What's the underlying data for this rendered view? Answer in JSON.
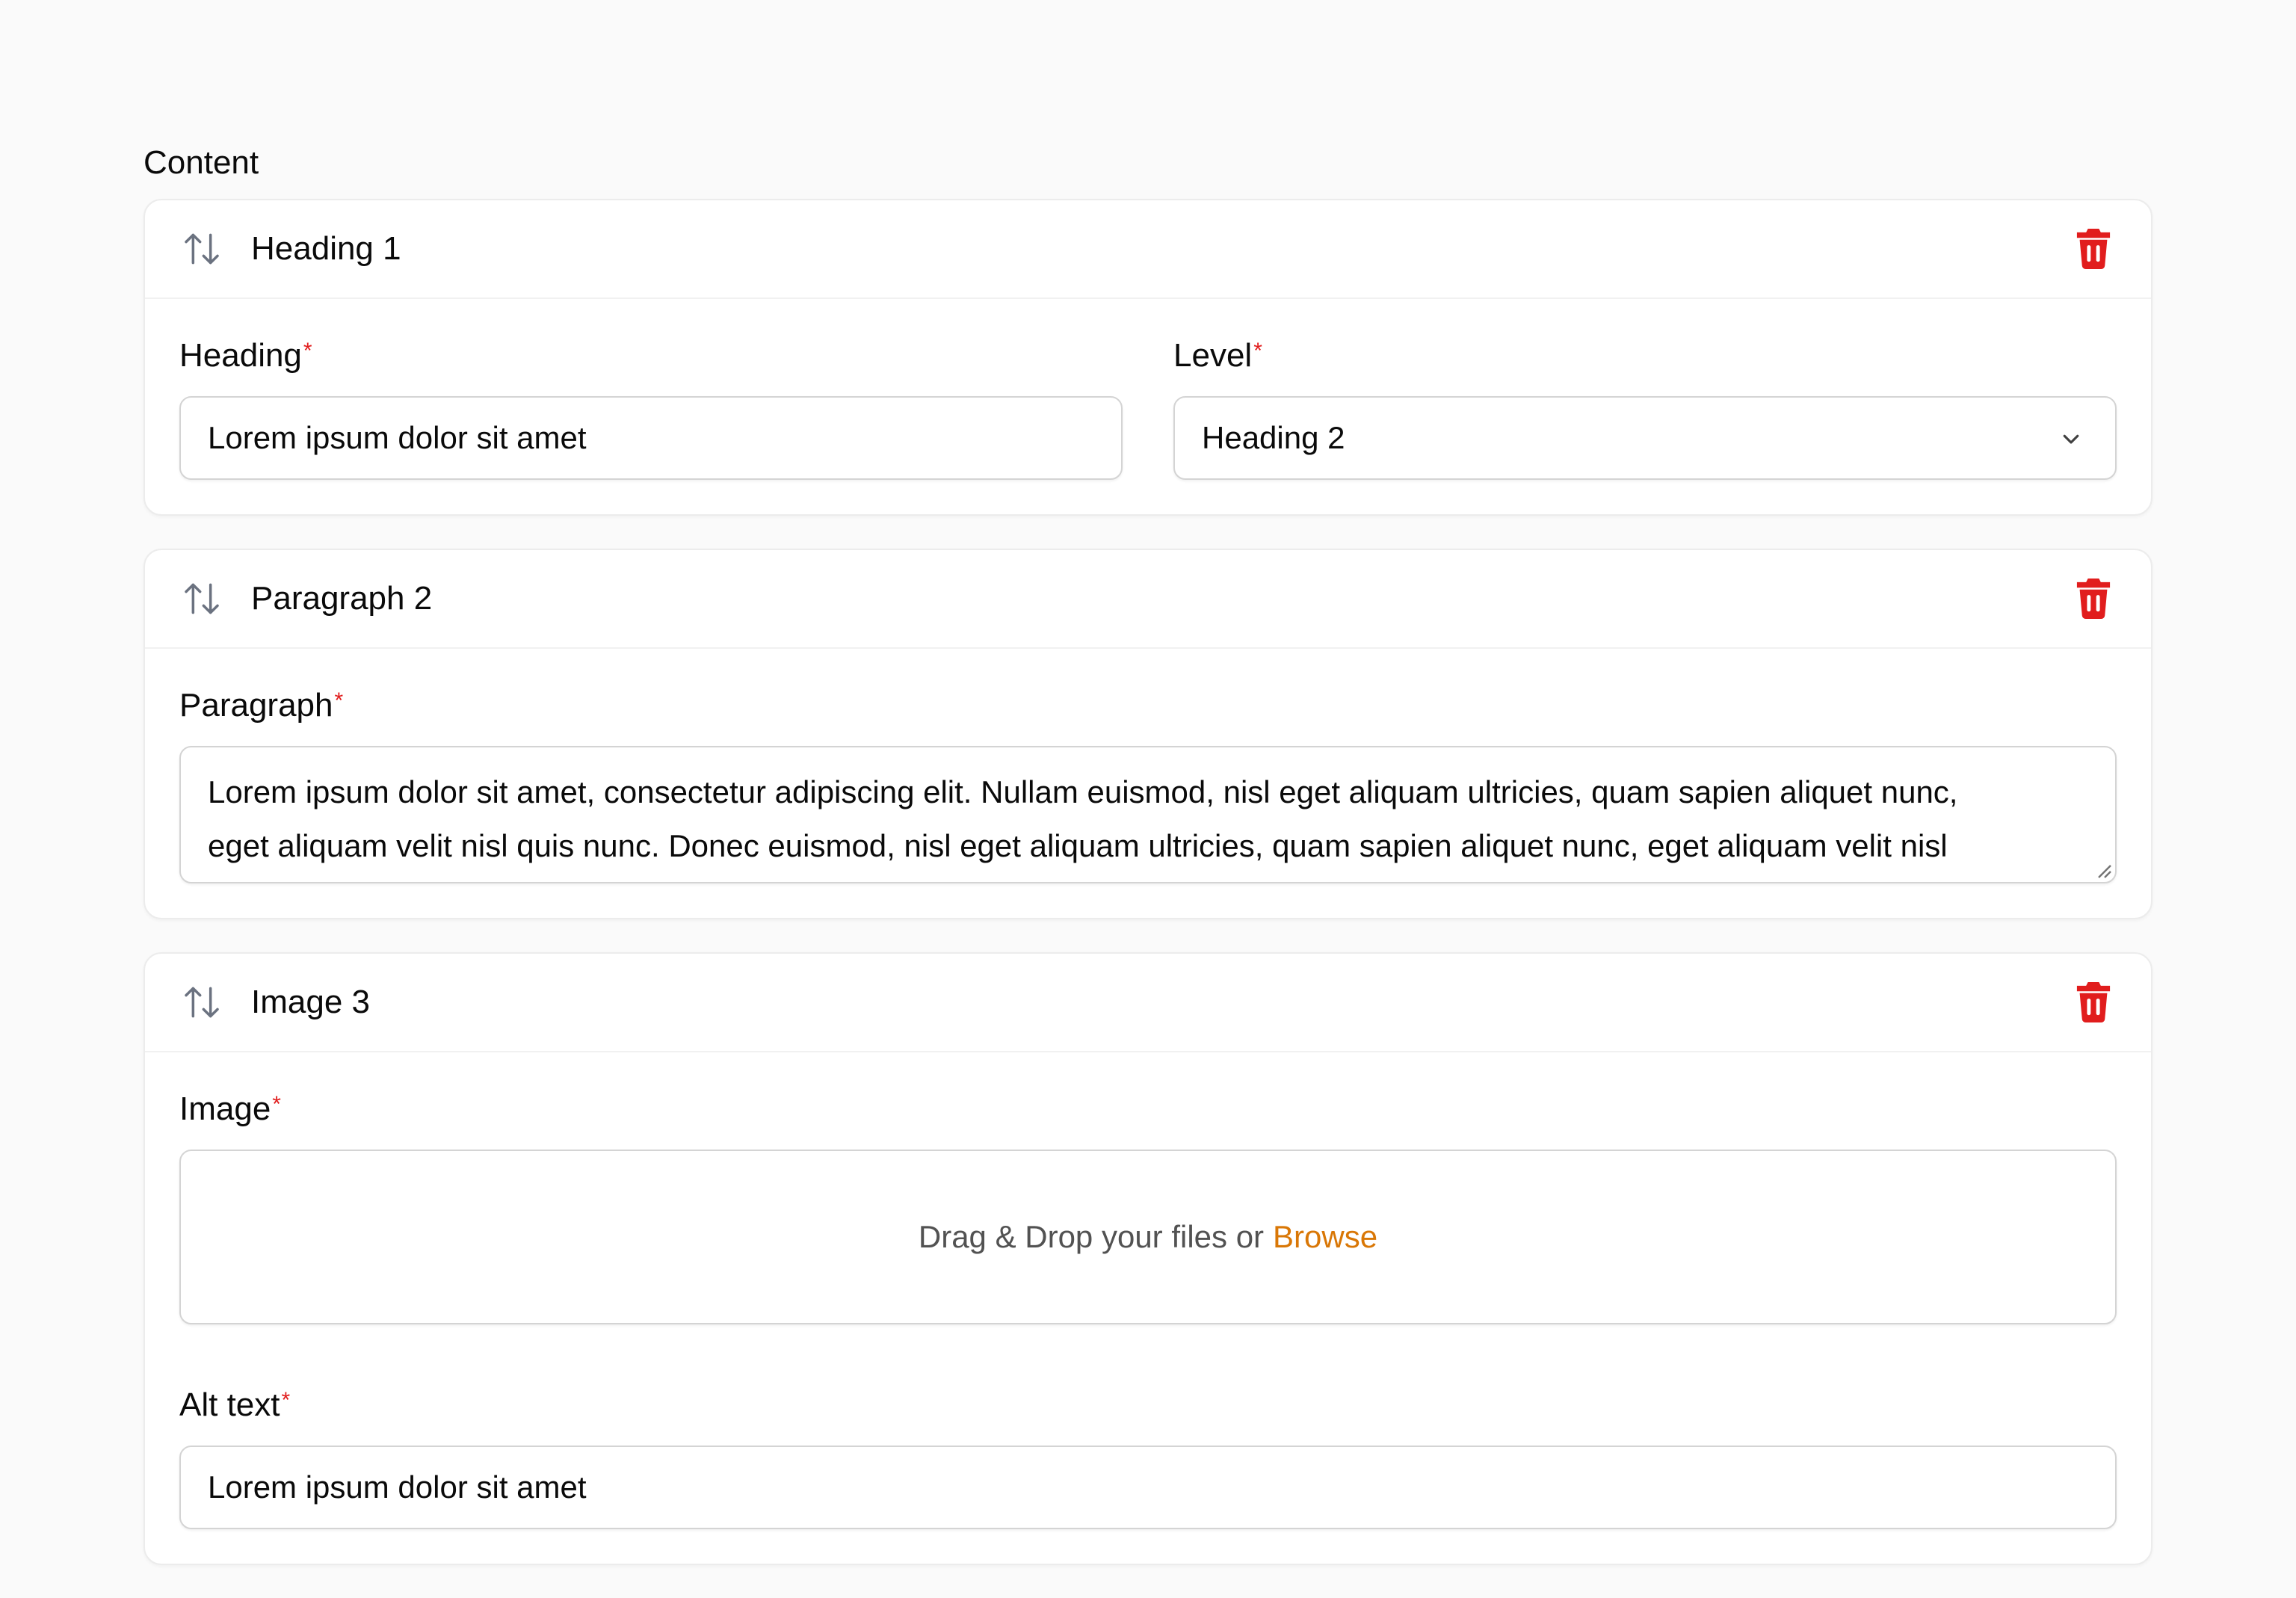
{
  "section_label": "Content",
  "blocks": [
    {
      "title": "Heading 1",
      "fields": {
        "heading": {
          "label": "Heading",
          "value": "Lorem ipsum dolor sit amet"
        },
        "level": {
          "label": "Level",
          "value": "Heading 2"
        }
      }
    },
    {
      "title": "Paragraph 2",
      "fields": {
        "paragraph": {
          "label": "Paragraph",
          "line1": "Lorem ipsum dolor sit amet, consectetur adipiscing elit. Nullam euismod, nisl eget aliquam ultricies, quam sapien aliquet nunc,",
          "line2": "eget aliquam velit nisl quis nunc. Donec euismod, nisl eget aliquam ultricies, quam sapien aliquet nunc, eget aliquam velit nisl"
        }
      }
    },
    {
      "title": "Image 3",
      "fields": {
        "image": {
          "label": "Image",
          "drop_text": "Drag & Drop your files or",
          "browse_label": "Browse"
        },
        "alt": {
          "label": "Alt text",
          "value": "Lorem ipsum dolor sit amet"
        }
      }
    }
  ],
  "required_marker": "*",
  "icons": {
    "sort": "sort-arrows-icon",
    "delete": "trash-icon",
    "dropdown": "chevron-down-icon"
  },
  "colors": {
    "danger": "#e11d1d",
    "accent": "#d97706",
    "border": "#d4d4d4"
  }
}
